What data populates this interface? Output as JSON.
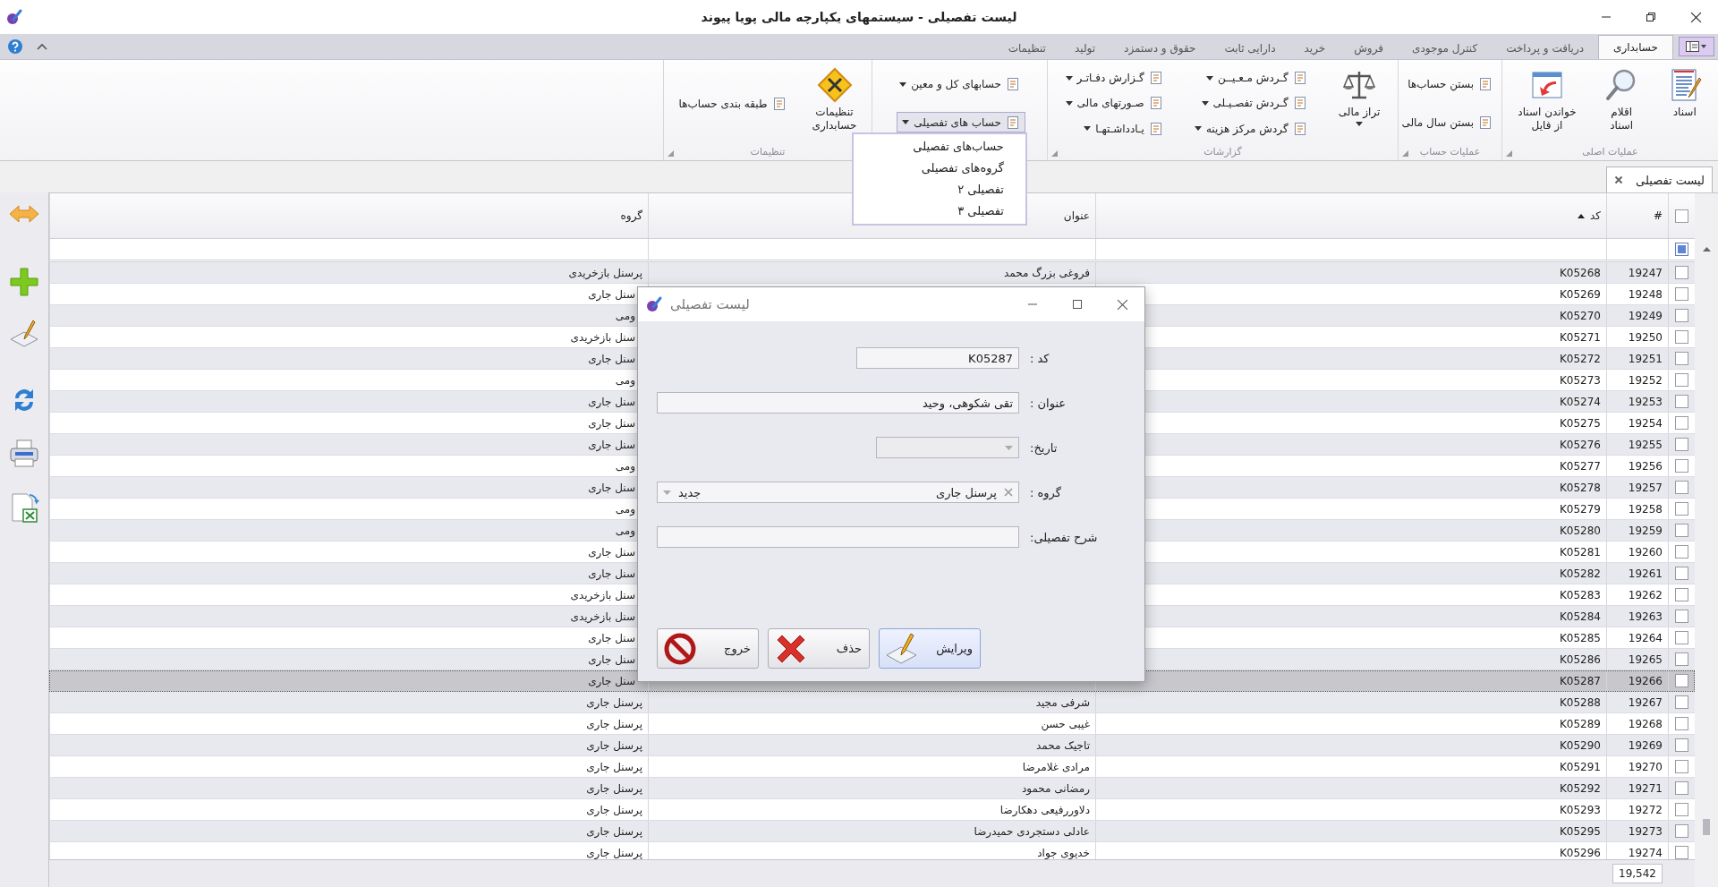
{
  "window": {
    "title": "لیست تفصیلی - سیستمهای یکپارچه مالی پویا پیوند"
  },
  "ribbon_tabs": [
    {
      "label": "حسابداری",
      "selected": true
    },
    {
      "label": "دریافت و پرداخت",
      "selected": false
    },
    {
      "label": "کنترل موجودی",
      "selected": false
    },
    {
      "label": "فروش",
      "selected": false
    },
    {
      "label": "خرید",
      "selected": false
    },
    {
      "label": "دارایی ثابت",
      "selected": false
    },
    {
      "label": "حقوق و دستمزد",
      "selected": false
    },
    {
      "label": "تولید",
      "selected": false
    },
    {
      "label": "تنظیمات",
      "selected": false
    }
  ],
  "ribbon_groups": [
    {
      "label": "عملیات اصلی",
      "columns": [
        [
          {
            "kind": "large",
            "label": "اسناد",
            "dropdown": false,
            "pressed": false
          }
        ],
        [
          {
            "kind": "large",
            "label": "اقلام\nاسناد",
            "dropdown": false,
            "pressed": false
          }
        ],
        [
          {
            "kind": "large",
            "label": "خواندن اسناد\nاز فایل",
            "dropdown": false,
            "pressed": false
          }
        ]
      ]
    },
    {
      "label": "عملیات حساب",
      "columns": [
        [
          {
            "kind": "small",
            "label": "بستن حساب‌ها",
            "dropdown": false,
            "pressed": false
          },
          {
            "kind": "small",
            "label": "بستن سال مالی",
            "dropdown": false,
            "pressed": false
          }
        ]
      ]
    },
    {
      "label": "گزارشات",
      "columns": [
        [
          {
            "kind": "large",
            "label": "تراز مالی",
            "dropdown": true,
            "pressed": false
          }
        ],
        [
          {
            "kind": "small",
            "label": "گـردش مـعـیــن",
            "dropdown": true,
            "pressed": false
          },
          {
            "kind": "small",
            "label": "گـردش تفصـیـلی",
            "dropdown": true,
            "pressed": false
          },
          {
            "kind": "small",
            "label": "گردش مرکز هزینه",
            "dropdown": true,
            "pressed": false
          }
        ],
        [
          {
            "kind": "small",
            "label": "گـزارش دفـاتـر",
            "dropdown": true,
            "pressed": false
          },
          {
            "kind": "small",
            "label": "صـورتهای مالی",
            "dropdown": true,
            "pressed": false
          },
          {
            "kind": "small",
            "label": "یـادداشـتهـا",
            "dropdown": true,
            "pressed": false
          }
        ]
      ]
    },
    {
      "columns": [
        [
          {
            "kind": "small",
            "label": "حسابهای کل و معین",
            "dropdown": true,
            "pressed": false
          },
          {
            "kind": "small",
            "label": "حساب های تفصیلی",
            "dropdown": true,
            "pressed": true,
            "menu": [
              {
                "label": "حساب‌های تفصیلی"
              },
              {
                "label": "گروه‌های تفصیلی"
              },
              {
                "label": "تفصیلی ۲"
              },
              {
                "label": "تفصیلی ۳"
              }
            ]
          }
        ]
      ]
    },
    {
      "label": "تنظیمات",
      "columns": [
        [
          {
            "kind": "large",
            "label": "تنظیمات\nحسابداری",
            "dropdown": false,
            "pressed": false
          }
        ],
        [
          {
            "kind": "small",
            "label": "طبقه بندی حساب‌ها",
            "dropdown": false,
            "pressed": false
          }
        ]
      ]
    }
  ],
  "document_tabs": [
    {
      "label": "لیست تفصیلی"
    }
  ],
  "grid": {
    "header_checked": false,
    "filter_checkbox_mixed": true,
    "columns": [
      {
        "label": "#"
      },
      {
        "label": "کد",
        "sort_ascending": true
      },
      {
        "label": "عنوان"
      },
      {
        "label": "گروه"
      }
    ],
    "rows": [
      {
        "checked": false,
        "selected": false,
        "number": "19247",
        "code": "K05268",
        "title": "فروغی بزرگ محمد",
        "group": "پرسنل بازخریدی"
      },
      {
        "checked": false,
        "selected": false,
        "number": "19248",
        "code": "K05269",
        "group": "سنل جاری"
      },
      {
        "checked": false,
        "selected": false,
        "number": "19249",
        "code": "K05270",
        "group": "ومی"
      },
      {
        "checked": false,
        "selected": false,
        "number": "19250",
        "code": "K05271",
        "group": "سنل بازخریدی"
      },
      {
        "checked": false,
        "selected": false,
        "number": "19251",
        "code": "K05272",
        "group": "سنل جاری"
      },
      {
        "checked": false,
        "selected": false,
        "number": "19252",
        "code": "K05273",
        "group": "ومی"
      },
      {
        "checked": false,
        "selected": false,
        "number": "19253",
        "code": "K05274",
        "group": "سنل جاری"
      },
      {
        "checked": false,
        "selected": false,
        "number": "19254",
        "code": "K05275",
        "group": "سنل جاری"
      },
      {
        "checked": false,
        "selected": false,
        "number": "19255",
        "code": "K05276",
        "group": "سنل جاری"
      },
      {
        "checked": false,
        "selected": false,
        "number": "19256",
        "code": "K05277",
        "group": "ومی"
      },
      {
        "checked": false,
        "selected": false,
        "number": "19257",
        "code": "K05278",
        "group": "سنل جاری"
      },
      {
        "checked": false,
        "selected": false,
        "number": "19258",
        "code": "K05279",
        "group": "ومی"
      },
      {
        "checked": false,
        "selected": false,
        "number": "19259",
        "code": "K05280",
        "group": "ومی"
      },
      {
        "checked": false,
        "selected": false,
        "number": "19260",
        "code": "K05281",
        "group": "سنل جاری"
      },
      {
        "checked": false,
        "selected": false,
        "number": "19261",
        "code": "K05282",
        "group": "سنل جاری"
      },
      {
        "checked": false,
        "selected": false,
        "number": "19262",
        "code": "K05283",
        "group": "سنل بازخریدی"
      },
      {
        "checked": false,
        "selected": false,
        "number": "19263",
        "code": "K05284",
        "group": "سنل بازخریدی"
      },
      {
        "checked": false,
        "selected": false,
        "number": "19264",
        "code": "K05285",
        "group": "سنل جاری"
      },
      {
        "checked": false,
        "selected": false,
        "number": "19265",
        "code": "K05286",
        "group": "سنل جاری"
      },
      {
        "checked": false,
        "selected": true,
        "number": "19266",
        "code": "K05287",
        "group": "سنل جاری"
      },
      {
        "checked": false,
        "selected": false,
        "number": "19267",
        "code": "K05288",
        "title": "شرفی مجید",
        "group": "پرسنل جاری"
      },
      {
        "checked": false,
        "selected": false,
        "number": "19268",
        "code": "K05289",
        "title": "غیبی حسن",
        "group": "پرسنل جاری"
      },
      {
        "checked": false,
        "selected": false,
        "number": "19269",
        "code": "K05290",
        "title": "تاجیک محمد",
        "group": "پرسنل جاری"
      },
      {
        "checked": false,
        "selected": false,
        "number": "19270",
        "code": "K05291",
        "title": "مرادی غلامرضا",
        "group": "پرسنل جاری"
      },
      {
        "checked": false,
        "selected": false,
        "number": "19271",
        "code": "K05292",
        "title": "رمضانی محمود",
        "group": "پرسنل جاری"
      },
      {
        "checked": false,
        "selected": false,
        "number": "19272",
        "code": "K05293",
        "title": "دلاوررفیعی دهکارضا",
        "group": "پرسنل جاری"
      },
      {
        "checked": false,
        "selected": false,
        "number": "19273",
        "code": "K05295",
        "title": "عادلی دستجردی حمیدرضا",
        "group": "پرسنل جاری"
      },
      {
        "checked": false,
        "selected": false,
        "number": "19274",
        "code": "K05296",
        "title": "خدیوی جواد",
        "group": "پرسنل جاری"
      }
    ],
    "footer_count": "19,542"
  },
  "dialog": {
    "title": "لیست تفصیلی",
    "fields": [
      {
        "kind": "code",
        "label": "کد :",
        "value": "K05287"
      },
      {
        "kind": "text",
        "label": "عنوان :",
        "value": "تقی شکوهی،  وحید"
      },
      {
        "kind": "date",
        "label": "تاریخ:"
      },
      {
        "kind": "lookup",
        "label": "گروه :",
        "value": "پرسنل جاری",
        "extra": "جدید"
      },
      {
        "kind": "text",
        "label": "شرح تفصیلی:"
      }
    ],
    "buttons": [
      {
        "kind": "edit",
        "label": "ویرایش",
        "focused": true
      },
      {
        "kind": "delete",
        "label": "حذف",
        "focused": false
      },
      {
        "kind": "exit",
        "label": "خروج",
        "focused": false
      }
    ]
  }
}
